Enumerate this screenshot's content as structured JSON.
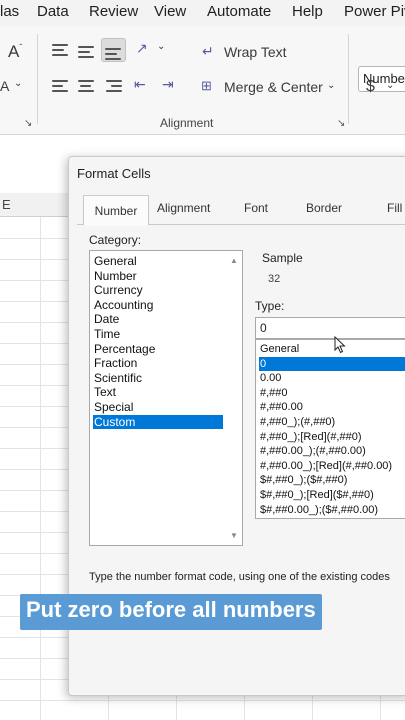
{
  "menu": {
    "items": [
      "las",
      "Data",
      "Review",
      "View",
      "Automate",
      "Help",
      "Power Piv"
    ]
  },
  "ribbon": {
    "font_size_glyph": "A",
    "font_glyph": "A",
    "wrap_text_label": "Wrap Text",
    "merge_center_label": "Merge & Center",
    "alignment_group_label": "Alignment",
    "number_format_value": "Number",
    "currency_symbol": "$"
  },
  "sheet": {
    "column_header": "E"
  },
  "dialog": {
    "title": "Format Cells",
    "tabs": [
      "Number",
      "Alignment",
      "Font",
      "Border",
      "Fill"
    ],
    "category_label": "Category:",
    "categories": [
      "General",
      "Number",
      "Currency",
      "Accounting",
      "Date",
      "Time",
      "Percentage",
      "Fraction",
      "Scientific",
      "Text",
      "Special",
      "Custom"
    ],
    "selected_category": "Custom",
    "sample_label": "Sample",
    "sample_value": "32",
    "type_label": "Type:",
    "type_value": "0",
    "formats": [
      "General",
      "0",
      "0.00",
      "#,##0",
      "#,##0.00",
      "#,##0_);(#,##0)",
      "#,##0_);[Red](#,##0)",
      "#,##0.00_);(#,##0.00)",
      "#,##0.00_);[Red](#,##0.00)",
      "$#,##0_);($#,##0)",
      "$#,##0_);[Red]($#,##0)",
      "$#,##0.00_);($#,##0.00)"
    ],
    "selected_format": "0",
    "hint": "Type the number format code, using one of the existing codes"
  },
  "caption": {
    "text": "Put zero before all numbers"
  },
  "colors": {
    "selection": "#0078d7",
    "caption_bg": "#5b9bd5"
  }
}
